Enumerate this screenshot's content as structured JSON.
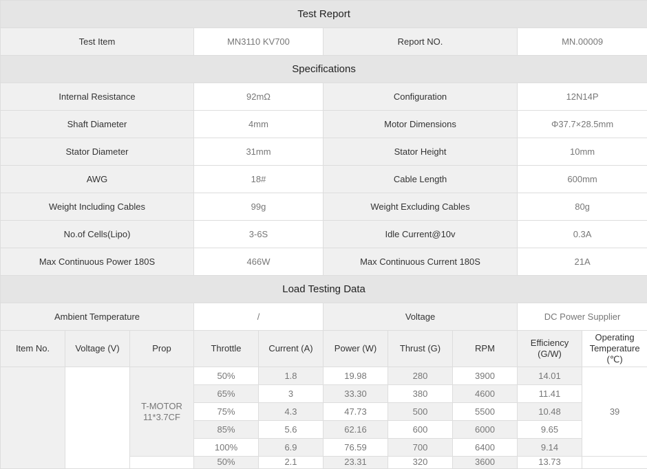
{
  "sections": {
    "test_report": "Test Report",
    "specifications": "Specifications",
    "load_testing": "Load Testing Data"
  },
  "header_info": {
    "test_item_label": "Test Item",
    "test_item_value": "MN3110 KV700",
    "report_no_label": "Report NO.",
    "report_no_value": "MN.00009"
  },
  "specs": [
    {
      "k1": "Internal Resistance",
      "v1": "92mΩ",
      "k2": "Configuration",
      "v2": "12N14P"
    },
    {
      "k1": "Shaft Diameter",
      "v1": "4mm",
      "k2": "Motor Dimensions",
      "v2": "Φ37.7×28.5mm"
    },
    {
      "k1": "Stator Diameter",
      "v1": "31mm",
      "k2": "Stator Height",
      "v2": "10mm"
    },
    {
      "k1": "AWG",
      "v1": "18#",
      "k2": "Cable Length",
      "v2": "600mm"
    },
    {
      "k1": "Weight Including Cables",
      "v1": "99g",
      "k2": "Weight Excluding Cables",
      "v2": "80g"
    },
    {
      "k1": "No.of Cells(Lipo)",
      "v1": "3-6S",
      "k2": "Idle Current@10v",
      "v2": "0.3A"
    },
    {
      "k1": "Max Continuous Power 180S",
      "v1": "466W",
      "k2": "Max Continuous Current 180S",
      "v2": "21A"
    }
  ],
  "load": {
    "ambient_label": "Ambient Temperature",
    "ambient_value": "/",
    "voltage_label": "Voltage",
    "voltage_value": "DC Power Supplier",
    "columns": [
      "Item No.",
      "Voltage (V)",
      "Prop",
      "Throttle",
      "Current (A)",
      "Power (W)",
      "Thrust (G)",
      "RPM",
      "Efficiency (G/W)",
      "Operating Temperature (℃)"
    ],
    "group1": {
      "prop": "T-MOTOR 11*3.7CF",
      "operating_temp": "39",
      "rows": [
        {
          "throttle": "50%",
          "current": "1.8",
          "power": "19.98",
          "thrust": "280",
          "rpm": "3900",
          "efficiency": "14.01"
        },
        {
          "throttle": "65%",
          "current": "3",
          "power": "33.30",
          "thrust": "380",
          "rpm": "4600",
          "efficiency": "11.41"
        },
        {
          "throttle": "75%",
          "current": "4.3",
          "power": "47.73",
          "thrust": "500",
          "rpm": "5500",
          "efficiency": "10.48"
        },
        {
          "throttle": "85%",
          "current": "5.6",
          "power": "62.16",
          "thrust": "600",
          "rpm": "6000",
          "efficiency": "9.65"
        },
        {
          "throttle": "100%",
          "current": "6.9",
          "power": "76.59",
          "thrust": "700",
          "rpm": "6400",
          "efficiency": "9.14"
        }
      ]
    },
    "partial_row": {
      "throttle": "50%",
      "current": "2.1",
      "power": "23.31",
      "thrust": "320",
      "rpm": "3600",
      "efficiency": "13.73"
    }
  }
}
